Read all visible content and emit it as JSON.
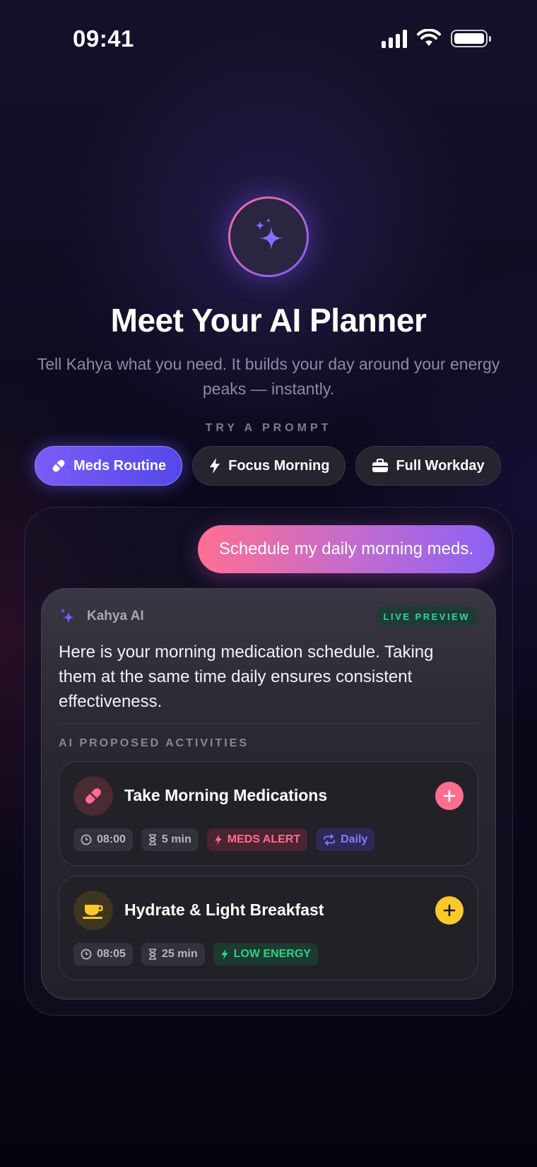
{
  "status_bar": {
    "time": "09:41"
  },
  "hero": {
    "title": "Meet Your AI Planner",
    "subtitle": "Tell Kahya what you need. It builds your day around your energy peaks — instantly."
  },
  "prompts": {
    "label": "TRY A PROMPT",
    "items": [
      {
        "label": "Meds Routine",
        "icon": "pill-icon",
        "active": true
      },
      {
        "label": "Focus Morning",
        "icon": "bolt-icon",
        "active": false
      },
      {
        "label": "Full Workday",
        "icon": "briefcase-icon",
        "active": false
      }
    ]
  },
  "chat": {
    "user_message": "Schedule my daily morning meds.",
    "ai": {
      "name": "Kahya AI",
      "badge": "LIVE PREVIEW",
      "message": "Here is your morning medication schedule. Taking them at the same time daily ensures consistent effectiveness.",
      "section_label": "AI PROPOSED ACTIVITIES",
      "activities": [
        {
          "title": "Take Morning Medications",
          "icon": "pill-icon",
          "accent": "#ff6d8f",
          "time": "08:00",
          "duration": "5 min",
          "energy_tag": "MEDS ALERT",
          "repeat": "Daily"
        },
        {
          "title": "Hydrate & Light Breakfast",
          "icon": "cup-icon",
          "accent": "#fcc92a",
          "time": "08:05",
          "duration": "25 min",
          "energy_tag": "LOW ENERGY"
        }
      ]
    }
  },
  "colors": {
    "accent_purple": "#7a5cf7",
    "accent_pink": "#ff6f93",
    "live_green": "#2dd89a",
    "yellow": "#fcc92a"
  }
}
